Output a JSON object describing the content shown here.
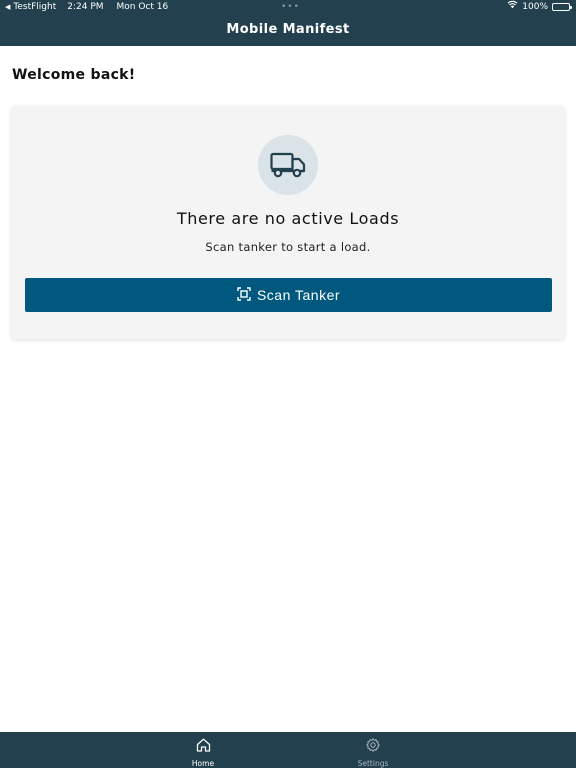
{
  "status_bar": {
    "back_app": "TestFlight",
    "time": "2:24 PM",
    "date": "Mon Oct 16",
    "battery": "100%",
    "multitask_dots": "•••"
  },
  "header": {
    "title": "Mobile Manifest"
  },
  "main": {
    "greeting": "Welcome back!",
    "empty_state": {
      "icon": "truck-icon",
      "title": "There are no active Loads",
      "subtitle": "Scan tanker to start a load.",
      "button_label": "Scan Tanker",
      "button_icon": "scan-icon"
    }
  },
  "tab_bar": {
    "items": [
      {
        "label": "Home",
        "icon": "home-icon",
        "active": true
      },
      {
        "label": "Settings",
        "icon": "gear-icon",
        "active": false
      }
    ]
  },
  "colors": {
    "header_bg": "#23404f",
    "primary": "#00587f",
    "card_bg": "#f4f4f4",
    "icon_circle": "#d9e3e8"
  }
}
